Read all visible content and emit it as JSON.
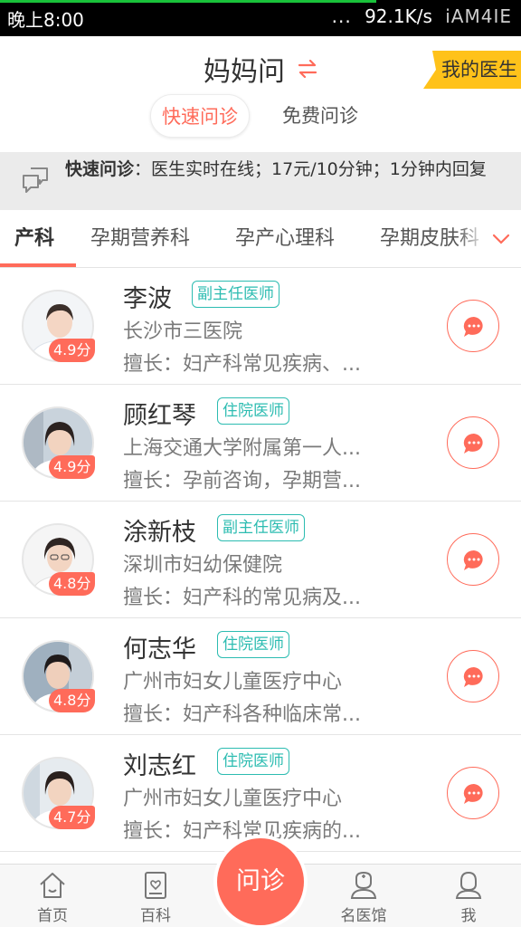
{
  "status_bar": {
    "time": "晚上8:00",
    "dots": "...",
    "speed": "92.1K/s",
    "network": "iAM4IE"
  },
  "header": {
    "title": "妈妈问",
    "my_doctor": "我的医生",
    "tabs": [
      {
        "label": "快速问诊",
        "active": true
      },
      {
        "label": "免费问诊",
        "active": false
      }
    ]
  },
  "info_bar": {
    "label": "快速问诊",
    "text": "：医生实时在线；17元/10分钟；1分钟内回复"
  },
  "departments": [
    "产科",
    "孕期营养科",
    "孕产心理科",
    "孕期皮肤科"
  ],
  "doctors": [
    {
      "name": "李波",
      "title": "副主任医师",
      "hospital": "长沙市三医院",
      "skill": "擅长：妇产科常见疾病、...",
      "rating": "4.9分"
    },
    {
      "name": "顾红琴",
      "title": "住院医师",
      "hospital": "上海交通大学附属第一人...",
      "skill": "擅长：孕前咨询，孕期营...",
      "rating": "4.9分"
    },
    {
      "name": "涂新枝",
      "title": "副主任医师",
      "hospital": "深圳市妇幼保健院",
      "skill": "擅长：妇产科的常见病及...",
      "rating": "4.8分"
    },
    {
      "name": "何志华",
      "title": "住院医师",
      "hospital": "广州市妇女儿童医疗中心",
      "skill": "擅长：妇产科各种临床常...",
      "rating": "4.8分"
    },
    {
      "name": "刘志红",
      "title": "住院医师",
      "hospital": "广州市妇女儿童医疗中心",
      "skill": "擅长：妇产科常见疾病的...",
      "rating": "4.7分"
    }
  ],
  "bottom_nav": [
    {
      "label": "首页",
      "icon": "home-icon"
    },
    {
      "label": "百科",
      "icon": "book-icon"
    },
    {
      "label": "名医馆",
      "icon": "doctor-icon"
    },
    {
      "label": "我",
      "icon": "user-icon"
    }
  ],
  "center_button": "问诊",
  "colors": {
    "accent": "#ff6b5a",
    "badge": "#2cbcb1",
    "my_doctor_tag": "#ffc21a"
  }
}
